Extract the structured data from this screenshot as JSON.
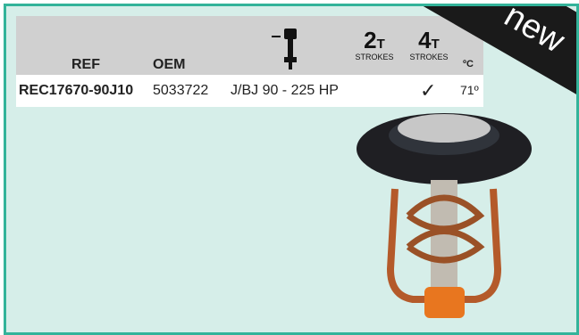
{
  "header": {
    "ref_label": "REF",
    "oem_label": "OEM",
    "engine_icon": "outboard-motor-icon",
    "two_stroke": {
      "big": "2",
      "unit": "T",
      "sub": "STROKES"
    },
    "four_stroke": {
      "big": "4",
      "unit": "T",
      "sub": "STROKES"
    },
    "temp_label": "ºC"
  },
  "product": {
    "ref": "REC17670-90J10",
    "oem": "5033722",
    "application": "J/BJ 90 - 225 HP",
    "four_stroke_mark": "✓",
    "temperature": "71º"
  },
  "badge": {
    "text": "new"
  },
  "image": {
    "subject": "thermostat-image"
  },
  "colors": {
    "border": "#33b39a",
    "background": "#d6eee9",
    "header_bg": "#d0d0d0",
    "ribbon": "#1a1a1a"
  }
}
